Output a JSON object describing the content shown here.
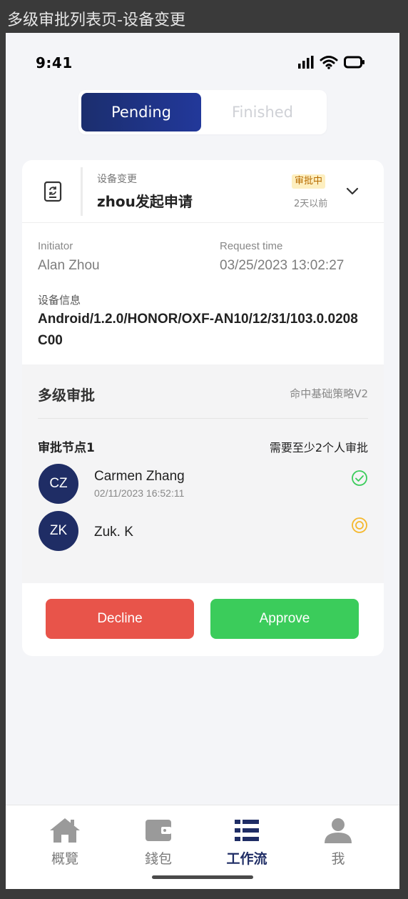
{
  "frame_title": "多级审批列表页-设备变更",
  "status_bar": {
    "time": "9:41"
  },
  "tabs": [
    {
      "label": "Pending",
      "active": true
    },
    {
      "label": "Finished",
      "active": false
    }
  ],
  "card": {
    "category": "设备变更",
    "title": "zhou发起申请",
    "status_badge": "审批中",
    "relative_time": "2天以前",
    "initiator_label": "Initiator",
    "initiator_value": "Alan Zhou",
    "request_time_label": "Request time",
    "request_time_value": "03/25/2023 13:02:27",
    "device_label": "设备信息",
    "device_value": "Android/1.2.0/HONOR/OXF-AN10/12/31/103.0.0208C00"
  },
  "approval": {
    "title": "多级审批",
    "policy": "命中基础策略V2",
    "node_title": "审批节点1",
    "node_rule": "需要至少2个人审批",
    "approvers": [
      {
        "initials": "CZ",
        "name": "Carmen Zhang",
        "time": "02/11/2023 16:52:11",
        "state": "approved"
      },
      {
        "initials": "ZK",
        "name": "Zuk. K",
        "time": "",
        "state": "pending"
      }
    ]
  },
  "actions": {
    "decline_label": "Decline",
    "approve_label": "Approve"
  },
  "bottom_nav": [
    {
      "label": "概覽",
      "icon": "home-icon",
      "active": false
    },
    {
      "label": "錢包",
      "icon": "wallet-icon",
      "active": false
    },
    {
      "label": "工作流",
      "icon": "workflow-icon",
      "active": true
    },
    {
      "label": "我",
      "icon": "user-icon",
      "active": false
    }
  ],
  "colors": {
    "primary": "#1f2d65",
    "decline": "#e8544a",
    "approve": "#3bcc5b",
    "badge_bg": "#fdefc0",
    "badge_text": "#b86b00",
    "approved_icon": "#3bcc5b",
    "pending_icon": "#f5b82e"
  }
}
